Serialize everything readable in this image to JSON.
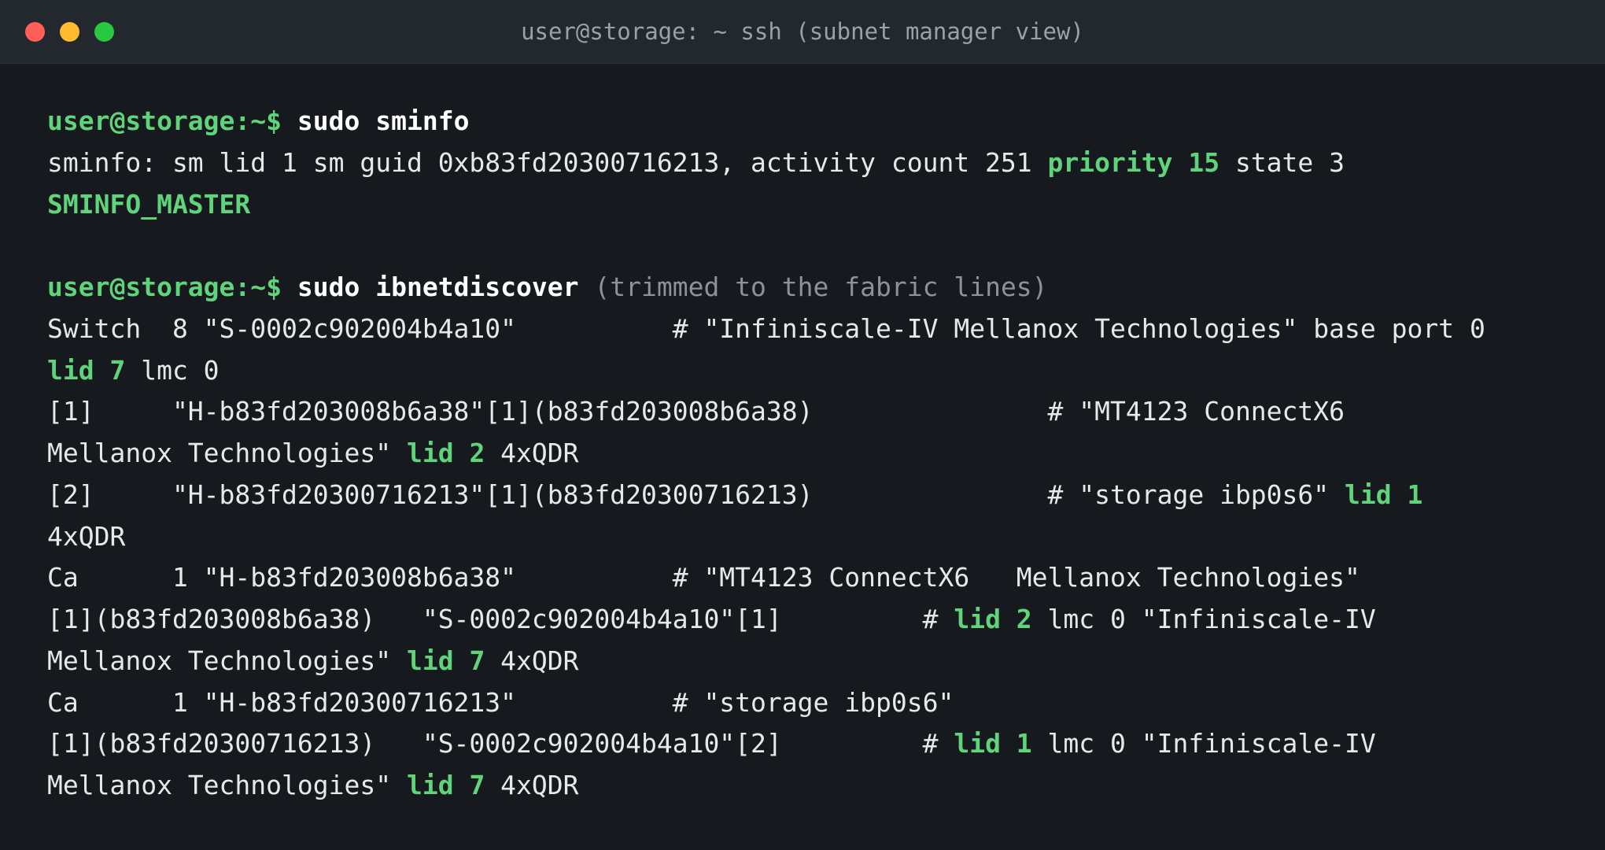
{
  "window": {
    "title": "user@storage: ~ ssh (subnet manager view)"
  },
  "colors": {
    "background": "#16191e",
    "titlebar": "#23272e",
    "prompt": "#5fd47a",
    "highlight": "#5fd47a",
    "text": "#e6e8eb",
    "muted": "#8b929c"
  },
  "terminal": {
    "lines": [
      [
        {
          "t": "user@storage:~$ ",
          "c": "prompt"
        },
        {
          "t": "sudo sminfo",
          "c": "cmd"
        }
      ],
      [
        {
          "t": "sminfo: sm lid 1 sm guid 0xb83fd20300716213, activity count 251 ",
          "c": ""
        },
        {
          "t": "priority 15",
          "c": "hl"
        },
        {
          "t": " state 3",
          "c": ""
        }
      ],
      [
        {
          "t": "SMINFO_MASTER",
          "c": "hl"
        }
      ],
      [],
      [
        {
          "t": "user@storage:~$ ",
          "c": "prompt"
        },
        {
          "t": "sudo ibnetdiscover",
          "c": "cmd"
        },
        {
          "t": " (trimmed to the fabric lines)",
          "c": "note"
        }
      ],
      [
        {
          "t": "Switch  8 \"S-0002c902004b4a10\"          # \"Infiniscale-IV Mellanox Technologies\" base port 0",
          "c": ""
        }
      ],
      [
        {
          "t": "lid 7",
          "c": "hl"
        },
        {
          "t": " lmc 0",
          "c": ""
        }
      ],
      [
        {
          "t": "[1]     \"H-b83fd203008b6a38\"[1](b83fd203008b6a38)               # \"MT4123 ConnectX6",
          "c": ""
        }
      ],
      [
        {
          "t": "Mellanox Technologies\" ",
          "c": ""
        },
        {
          "t": "lid 2",
          "c": "hl"
        },
        {
          "t": " 4xQDR",
          "c": ""
        }
      ],
      [
        {
          "t": "[2]     \"H-b83fd20300716213\"[1](b83fd20300716213)               # \"storage ibp0s6\" ",
          "c": ""
        },
        {
          "t": "lid 1",
          "c": "hl"
        }
      ],
      [
        {
          "t": "4xQDR",
          "c": ""
        }
      ],
      [
        {
          "t": "Ca      1 \"H-b83fd203008b6a38\"          # \"MT4123 ConnectX6   Mellanox Technologies\"",
          "c": ""
        }
      ],
      [
        {
          "t": "[1](b83fd203008b6a38)   \"S-0002c902004b4a10\"[1]         # ",
          "c": ""
        },
        {
          "t": "lid 2",
          "c": "hl"
        },
        {
          "t": " lmc 0 \"Infiniscale-IV",
          "c": ""
        }
      ],
      [
        {
          "t": "Mellanox Technologies\" ",
          "c": ""
        },
        {
          "t": "lid 7",
          "c": "hl"
        },
        {
          "t": " 4xQDR",
          "c": ""
        }
      ],
      [
        {
          "t": "Ca      1 \"H-b83fd20300716213\"          # \"storage ibp0s6\"",
          "c": ""
        }
      ],
      [
        {
          "t": "[1](b83fd20300716213)   \"S-0002c902004b4a10\"[2]         # ",
          "c": ""
        },
        {
          "t": "lid 1",
          "c": "hl"
        },
        {
          "t": " lmc 0 \"Infiniscale-IV",
          "c": ""
        }
      ],
      [
        {
          "t": "Mellanox Technologies\" ",
          "c": ""
        },
        {
          "t": "lid 7",
          "c": "hl"
        },
        {
          "t": " 4xQDR",
          "c": ""
        }
      ]
    ]
  }
}
